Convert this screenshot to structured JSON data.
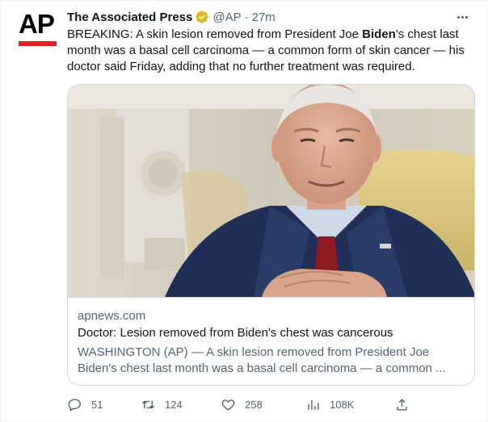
{
  "author": {
    "name": "The Associated Press",
    "handle": "@AP",
    "separator": "·",
    "time": "27m",
    "logo_text": "AP",
    "verified_color": "#e2b719"
  },
  "tweet": {
    "text_prefix": "BREAKING: A skin lesion removed from President Joe ",
    "text_bold": "Biden",
    "text_suffix": "'s chest last month was a basal cell carcinoma — a common form of skin cancer — his doctor said Friday, adding that no further treatment was required."
  },
  "card": {
    "domain": "apnews.com",
    "title": "Doctor: Lesion removed from Biden's chest was cancerous",
    "description": "WASHINGTON (AP) — A skin lesion removed from President Joe Biden's chest last month was a basal cell carcinoma — a common ...",
    "image_alt": "photo of President Joe Biden in the Oval Office"
  },
  "actions": {
    "reply": {
      "icon": "reply-icon",
      "count": "51"
    },
    "retweet": {
      "icon": "retweet-icon",
      "count": "124"
    },
    "like": {
      "icon": "heart-icon",
      "count": "258"
    },
    "views": {
      "icon": "views-icon",
      "count": "108K"
    },
    "share": {
      "icon": "share-icon"
    }
  },
  "colors": {
    "text": "#0f1419",
    "secondary": "#536471",
    "border": "#cfd9de",
    "ap_red": "#e41e25"
  }
}
